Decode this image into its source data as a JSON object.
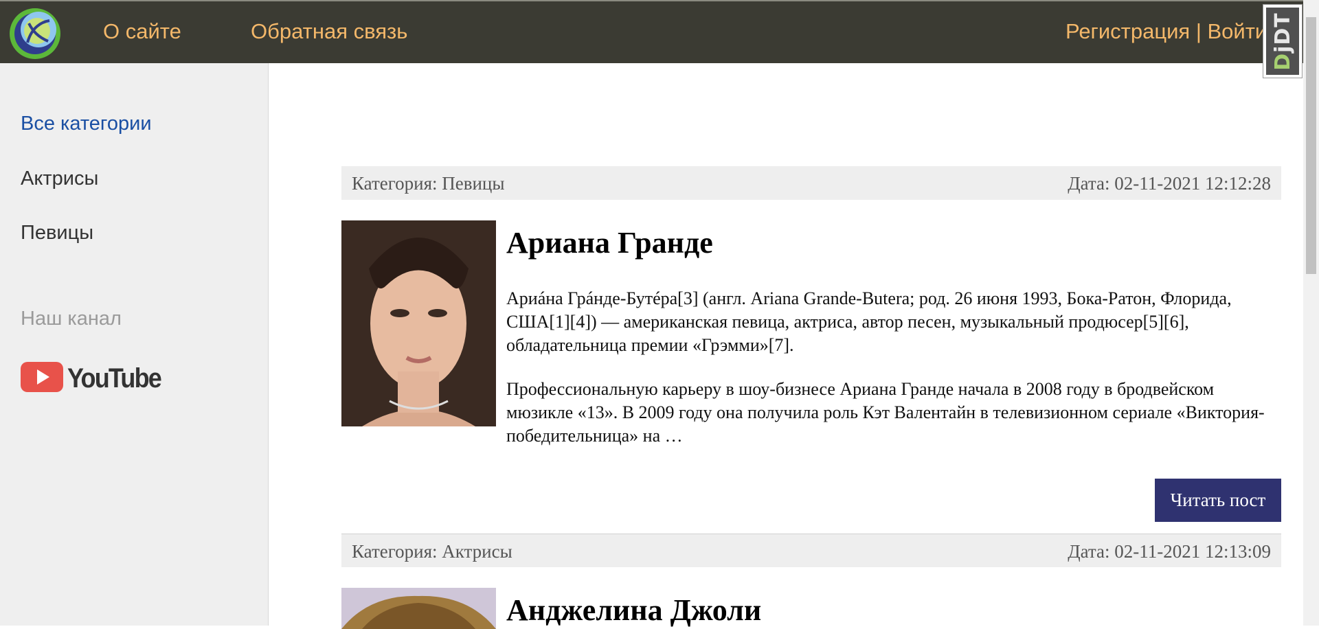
{
  "header": {
    "nav": {
      "about": "О сайте",
      "feedback": "Обратная связь"
    },
    "auth": {
      "register": "Регистрация",
      "separator": " | ",
      "login": "Войти"
    },
    "debug_toolbar": {
      "label_prefix": "D",
      "label_suffix": "jDT"
    }
  },
  "sidebar": {
    "items": [
      {
        "label": "Все категории"
      },
      {
        "label": "Актрисы"
      },
      {
        "label": "Певицы"
      }
    ],
    "channel_label": "Наш канал",
    "youtube_label": "YouTube"
  },
  "posts": [
    {
      "category": "Категория: Певицы",
      "date": "Дата: 02-11-2021 12:12:28",
      "title": "Ариана Гранде",
      "paragraphs": [
        "Ариáна Грáнде-Бутéра[3] (англ. Ariana Grande-Butera; род. 26 июня 1993, Бока-Ратон, Флорида, США[1][4]) — американская певица, актриса, автор песен, музыкальный продюсер[5][6], обладательница премии «Грэмми»[7].",
        "Профессиональную карьеру в шоу-бизнесе Ариана Гранде начала в 2008 году в бродвейском мюзикле «13». В 2009 году она получила роль Кэт Валентайн в телевизионном сериале «Виктория-победительница» на …"
      ],
      "button_label": "Читать пост"
    },
    {
      "category": "Категория: Актрисы",
      "date": "Дата: 02-11-2021 12:13:09",
      "title": "Анджелина Джоли"
    }
  ],
  "colors": {
    "header_bg": "#3b3b33",
    "nav_link": "#f4b86a",
    "active_category": "#1a4fa3",
    "button_bg": "#2f3270",
    "meta_bg": "#eeeeee",
    "youtube_red": "#e8524a"
  }
}
